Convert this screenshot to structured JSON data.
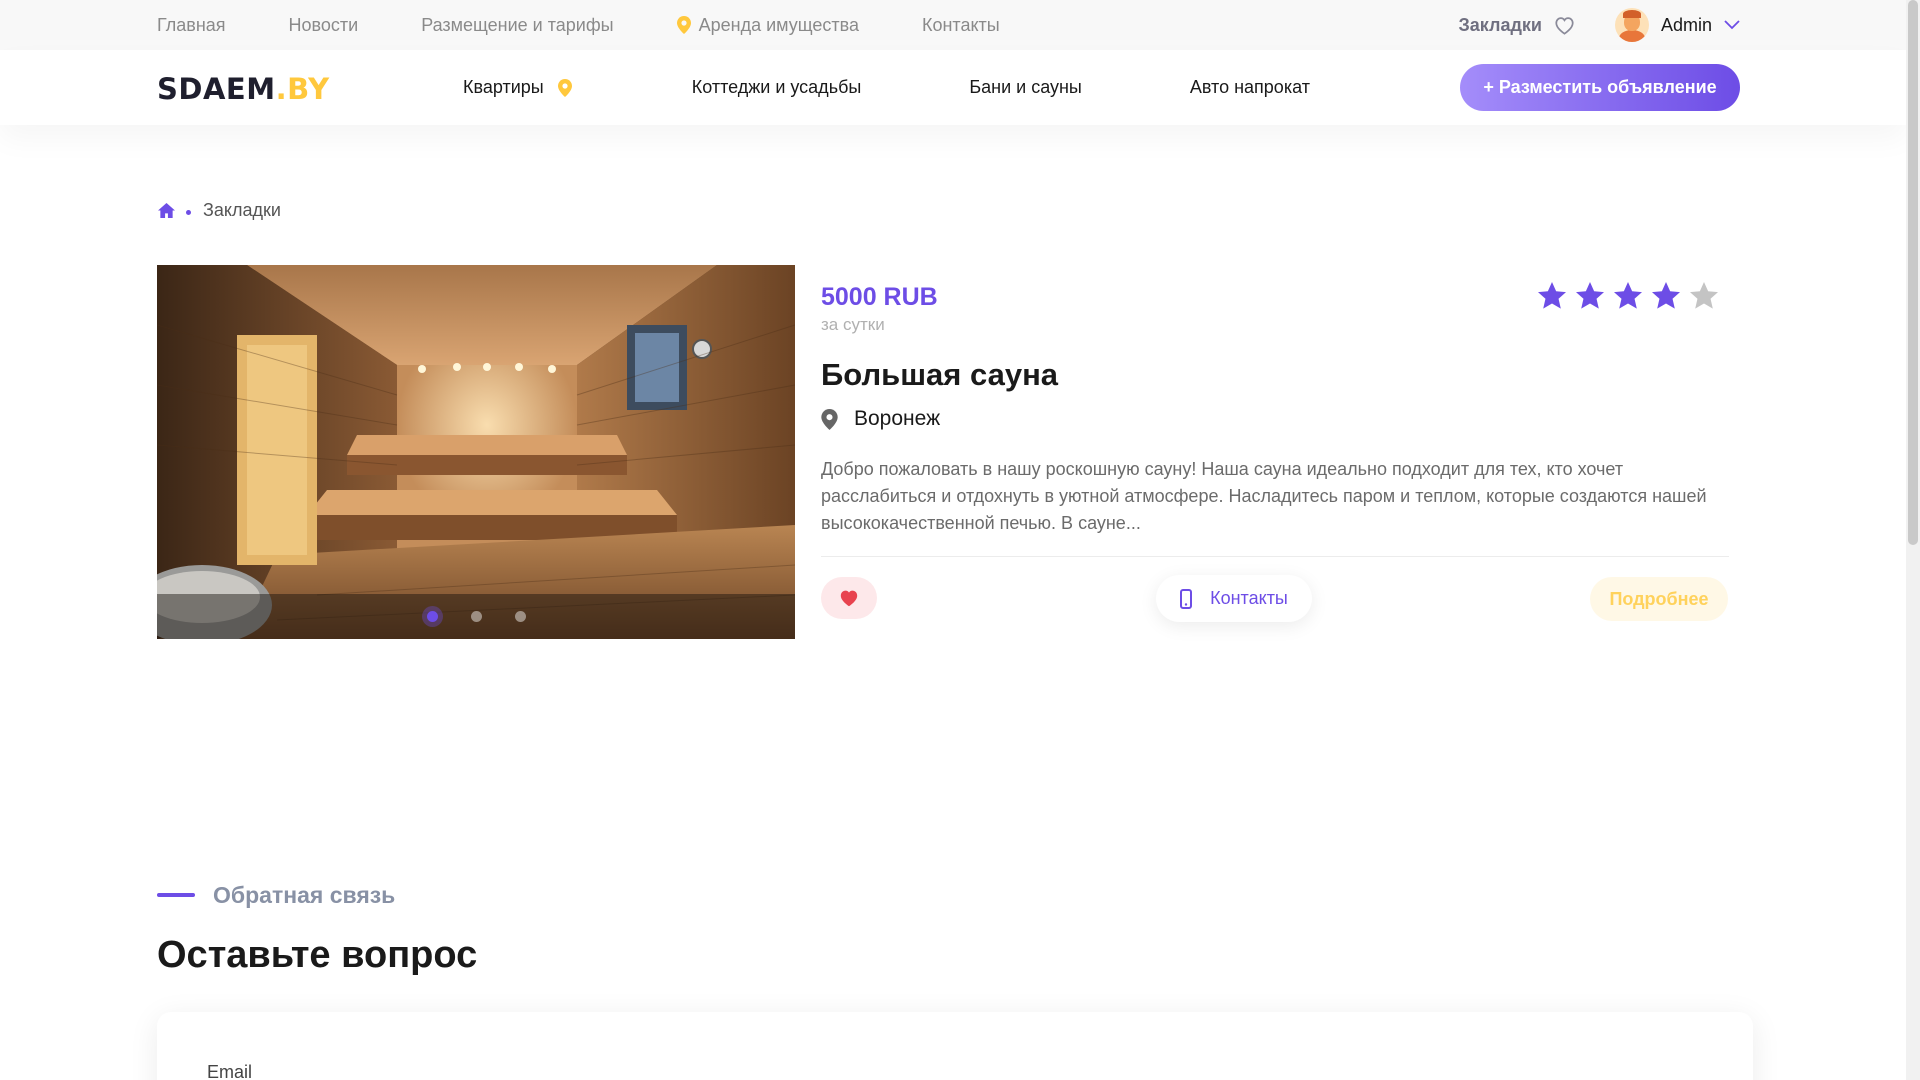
{
  "topbar": {
    "nav": [
      "Главная",
      "Новости",
      "Размещение и тарифы",
      "Аренда имущества",
      "Контакты"
    ],
    "bookmarks": "Закладки",
    "user_name": "Admin"
  },
  "header": {
    "logo_main": "SDAEM",
    "logo_accent": ".BY",
    "nav": [
      "Квартиры",
      "Коттеджи и усадьбы",
      "Бани и сауны",
      "Авто напрокат"
    ],
    "post_button": "+ Разместить объявление"
  },
  "breadcrumb": {
    "current": "Закладки"
  },
  "listing": {
    "price": "5000 RUB",
    "period": "за сутки",
    "rating": 4,
    "rating_max": 5,
    "title": "Большая сауна",
    "location": "Воронеж",
    "description": "Добро пожаловать в нашу роскошную сауну! Наша сауна идеально подходит для тех, кто хочет расслабиться и отдохнуть в уютной атмосфере. Насладитесь паром и теплом, которые создаются нашей высококачественной печью. В сауне...",
    "contacts_button": "Контакты",
    "details_button": "Подробнее",
    "image_slides": 3,
    "active_slide": 1
  },
  "feedback": {
    "label": "Обратная связь",
    "title": "Оставьте вопрос",
    "email_label": "Email"
  },
  "colors": {
    "accent": "#6d4de6",
    "logo_accent": "#ffc83d",
    "heart": "#e8434f"
  }
}
